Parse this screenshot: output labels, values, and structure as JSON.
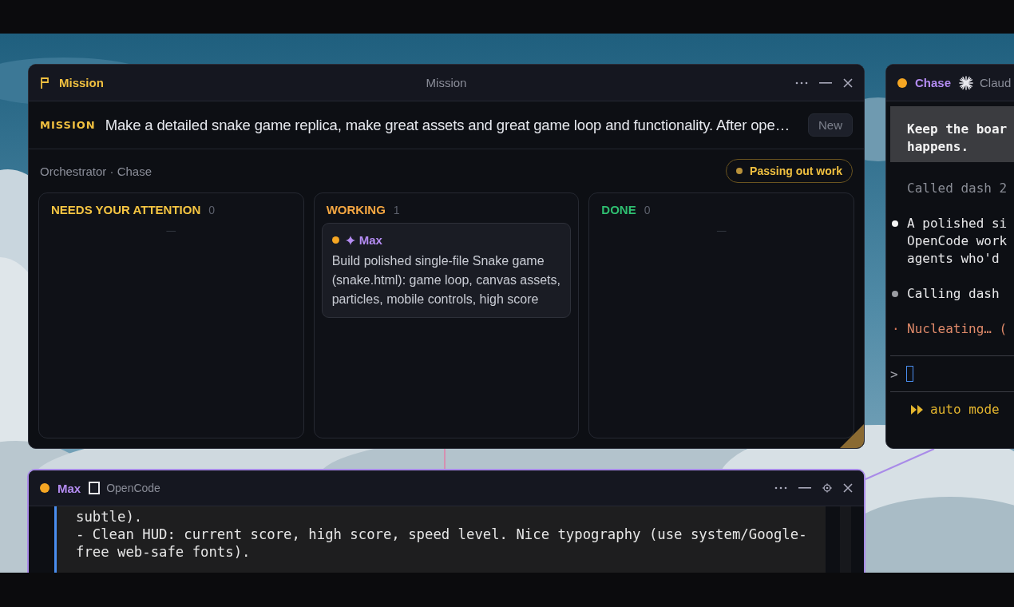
{
  "mission_window": {
    "title": "Mission",
    "center_title": "Mission",
    "mission_label": "MISSION",
    "mission_text": "Make a detailed snake game replica, make great assets and great game loop and functionality. After ope…",
    "new_button": "New",
    "orchestrator": "Orchestrator · Chase",
    "status": {
      "label": "Passing out work",
      "color": "#b8913a"
    },
    "columns": [
      {
        "title": "NEEDS YOUR ATTENTION",
        "count": "0",
        "color": "#f5c542",
        "empty_mark": "—"
      },
      {
        "title": "WORKING",
        "count": "1",
        "color": "#f5a742",
        "cards": [
          {
            "agent": "Max",
            "color": "#f5a623",
            "description": "Build polished single-file Snake game (snake.html): game loop, canvas assets, particles, mobile controls, high score"
          }
        ]
      },
      {
        "title": "DONE",
        "count": "0",
        "color": "#2fbf71",
        "empty_mark": "—"
      }
    ]
  },
  "chase_window": {
    "agent": "Chase",
    "color": "#f5a623",
    "tool": "Claud",
    "highlight_lines": [
      "Keep the boar",
      "happens."
    ],
    "entries": [
      {
        "kind": "muted",
        "lines": [
          "Called dash 2"
        ]
      },
      {
        "kind": "bullet-bright",
        "lines": [
          "A polished si",
          "OpenCode work",
          "agents who'd"
        ]
      },
      {
        "kind": "bullet-dim",
        "lines": [
          "Calling dash"
        ]
      },
      {
        "kind": "spinner",
        "marker": "·",
        "lines": [
          "Nucleating… ("
        ]
      }
    ],
    "prompt": ">",
    "mode": "auto mode"
  },
  "max_window": {
    "agent": "Max",
    "color": "#f5a623",
    "tool": "OpenCode",
    "focused": true,
    "lines": [
      "subtle).",
      "- Clean HUD: current score, high score, speed level. Nice typography (use system/Google-",
      "free web-safe fonts)."
    ]
  }
}
